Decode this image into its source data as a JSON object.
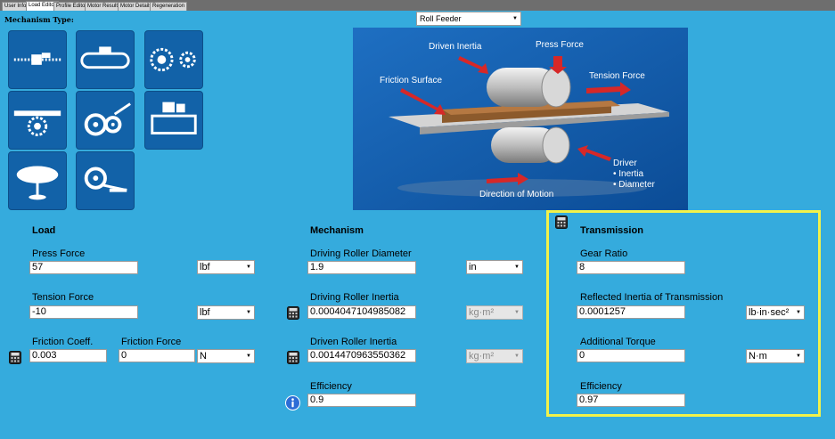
{
  "tabs": [
    {
      "label": "User Info"
    },
    {
      "label": "Load Editor"
    },
    {
      "label": "Profile Editor"
    },
    {
      "label": "Motor Results"
    },
    {
      "label": "Motor Details"
    },
    {
      "label": "Regeneration"
    }
  ],
  "mechanism_type_label": "Mechanism Type:",
  "mechanism_select": {
    "value": "Roll Feeder"
  },
  "diagram": {
    "driven_inertia": "Driven Inertia",
    "press_force": "Press Force",
    "friction_surface": "Friction Surface",
    "tension_force": "Tension Force",
    "driver": "Driver",
    "inertia": "• Inertia",
    "diameter": "• Diameter",
    "direction_of_motion": "Direction of Motion"
  },
  "load": {
    "title": "Load",
    "press_force_label": "Press Force",
    "press_force_value": "57",
    "press_force_unit": "lbf",
    "tension_force_label": "Tension Force",
    "tension_force_value": "-10",
    "tension_force_unit": "lbf",
    "friction_coeff_label": "Friction Coeff.",
    "friction_coeff_value": "0.003",
    "friction_force_label": "Friction Force",
    "friction_force_value": "0",
    "friction_force_unit": "N"
  },
  "mechanism": {
    "title": "Mechanism",
    "driving_diameter_label": "Driving Roller Diameter",
    "driving_diameter_value": "1.9",
    "driving_diameter_unit": "in",
    "driving_inertia_label": "Driving Roller  Inertia",
    "driving_inertia_value": "0.0004047104985082",
    "driving_inertia_unit": "kg·m²",
    "driven_inertia_label": "Driven Roller Inertia",
    "driven_inertia_value": "0.0014470963550362",
    "driven_inertia_unit": "kg·m²",
    "efficiency_label": "Efficiency",
    "efficiency_value": "0.9"
  },
  "transmission": {
    "title": "Transmission",
    "gear_ratio_label": "Gear Ratio",
    "gear_ratio_value": "8",
    "reflected_inertia_label": "Reflected Inertia of Transmission",
    "reflected_inertia_value": "0.0001257",
    "reflected_inertia_unit": "lb·in·sec²",
    "additional_torque_label": "Additional Torque",
    "additional_torque_value": "0",
    "additional_torque_unit": "N·m",
    "efficiency_label": "Efficiency",
    "efficiency_value": "0.97"
  },
  "colors": {
    "background": "#35ABDD",
    "button_blue": "#1262A8",
    "highlight": "#F2F24A"
  }
}
